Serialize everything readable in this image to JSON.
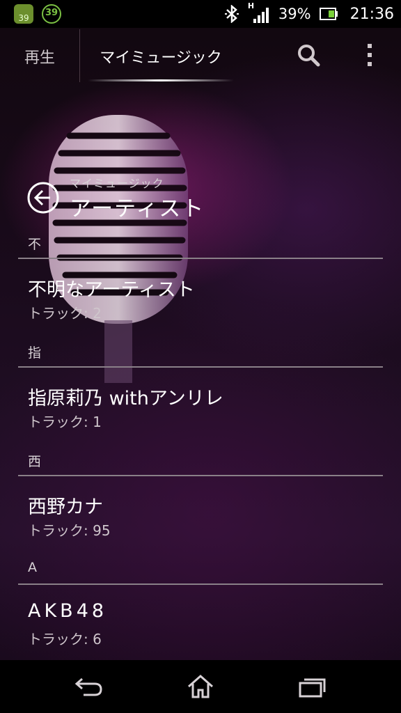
{
  "status_bar": {
    "notification_1": "39",
    "notification_2": "39",
    "network_type": "H",
    "battery_percent": "39%",
    "time": "21:36",
    "icons": [
      "android-notification-icon",
      "sync-notification-icon",
      "bluetooth-icon",
      "signal-icon",
      "battery-icon"
    ]
  },
  "action_bar": {
    "tabs": [
      {
        "label": "再生",
        "selected": false
      },
      {
        "label": "マイミュージック",
        "selected": true
      }
    ],
    "icons": [
      "search-icon",
      "overflow-menu-icon"
    ]
  },
  "header": {
    "subtitle": "マイミュージック",
    "title": "アーティスト",
    "back_icon": "back-circle-icon"
  },
  "sections": [
    {
      "index": "不",
      "artists": [
        {
          "name": "不明なアーティスト",
          "tracks": "トラック: 2"
        }
      ]
    },
    {
      "index": "指",
      "artists": [
        {
          "name": "指原莉乃 withアンリレ",
          "tracks": "トラック: 1"
        }
      ]
    },
    {
      "index": "西",
      "artists": [
        {
          "name": "西野カナ",
          "tracks": "トラック: 95"
        }
      ]
    },
    {
      "index": "A",
      "artists": [
        {
          "name": "AKB48",
          "tracks": "トラック: 6"
        }
      ]
    }
  ],
  "nav_bar": {
    "icons": [
      "back-icon",
      "home-icon",
      "recent-apps-icon"
    ]
  },
  "colors": {
    "background": "#1a0b1c",
    "accent_glow": "#961e78",
    "divider": "#8a8088"
  }
}
